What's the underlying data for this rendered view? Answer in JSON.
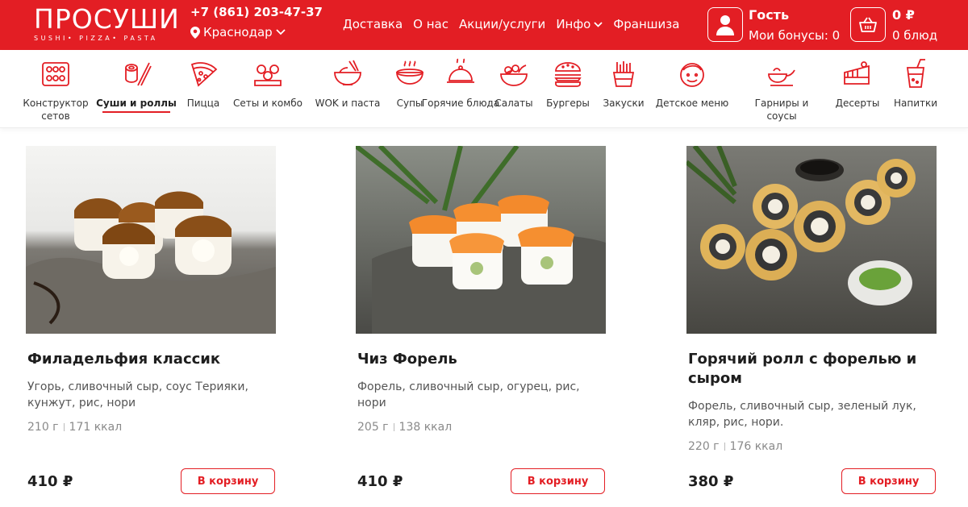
{
  "header": {
    "logo_text": "ПРОСУШИ",
    "logo_subtitle": "SUSHI• PIZZA• PASTA",
    "phone": "+7 (861) 203-47-37",
    "city": "Краснодар",
    "nav": [
      {
        "label": "Доставка"
      },
      {
        "label": "О нас"
      },
      {
        "label": "Акции/услуги"
      },
      {
        "label": "Инфо"
      },
      {
        "label": "Франшиза"
      }
    ],
    "user": {
      "name": "Гость",
      "bonus": "Мои бонусы: 0"
    },
    "cart": {
      "sum": "0 ₽",
      "count": "0 блюд"
    },
    "accent_color": "#e31e24"
  },
  "categories": [
    {
      "label": "Конструктор сетов",
      "icon": "set-builder-icon"
    },
    {
      "label": "Суши и роллы",
      "icon": "sushi-rolls-icon",
      "active": true
    },
    {
      "label": "Пицца",
      "icon": "pizza-icon"
    },
    {
      "label": "Сеты и комбо",
      "icon": "sets-combo-icon"
    },
    {
      "label": "WOK и паста",
      "icon": "wok-icon"
    },
    {
      "label": "Супы",
      "icon": "soup-icon"
    },
    {
      "label": "Горячие блюда",
      "icon": "hot-dish-icon"
    },
    {
      "label": "Салаты",
      "icon": "salad-icon"
    },
    {
      "label": "Бургеры",
      "icon": "burger-icon"
    },
    {
      "label": "Закуски",
      "icon": "snacks-icon"
    },
    {
      "label": "Детское меню",
      "icon": "kids-menu-icon"
    },
    {
      "label": "Гарниры и соусы",
      "icon": "sauce-icon"
    },
    {
      "label": "Десерты",
      "icon": "dessert-icon"
    },
    {
      "label": "Напитки",
      "icon": "drink-icon"
    }
  ],
  "products": [
    {
      "title": "Филадельфия классик",
      "description": "Угорь, сливочный сыр, соус Терияки, кунжут, рис, нори",
      "weight": "210 г",
      "calories": "171 ккал",
      "price": "410 ₽",
      "button": "В корзину"
    },
    {
      "title": "Чиз Форель",
      "description": "Форель, сливочный сыр, огурец, рис, нори",
      "weight": "205 г",
      "calories": "138 ккал",
      "price": "410 ₽",
      "button": "В корзину"
    },
    {
      "title": "Горячий ролл с форелью и сыром",
      "description": "Форель, сливочный сыр, зеленый лук, кляр, рис, нори.",
      "weight": "220 г",
      "calories": "176 ккал",
      "price": "380 ₽",
      "button": "В корзину"
    }
  ]
}
